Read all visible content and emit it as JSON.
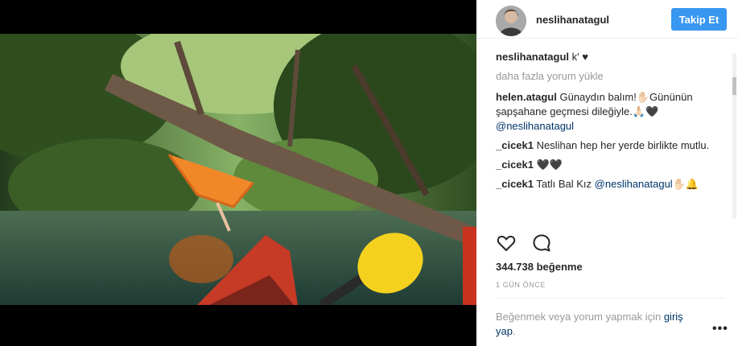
{
  "post": {
    "username": "neslihanatagul",
    "follow_label": "Takip Et",
    "caption": "k' ♥",
    "load_more": "daha fazla yorum yükle",
    "comments": [
      {
        "user": "helen.atagul",
        "text": "Günaydın balım!✋🏻Gününün şapşahane geçmesi dileğiyle.🙏🏻🖤",
        "mention": "@neslihanatagul"
      },
      {
        "user": "_cicek1",
        "text": "Neslihan hep her yerde birlikte mutlu."
      },
      {
        "user": "_cicek1",
        "text": "🖤🖤"
      },
      {
        "user": "_cicek1",
        "text": "Tatlı Bal Kız",
        "mention": "@neslihanatagul",
        "suffix": "✋🏻🔔"
      }
    ],
    "likes": "344.738 beğenme",
    "timestamp": "1 GÜN ÖNCE",
    "login_prompt": "Beğenmek veya yorum yapmak için",
    "login_link": "giriş yap",
    "login_suffix": ".",
    "more_label": "•••"
  },
  "icons": {
    "like": "heart-icon",
    "comment": "comment-icon"
  },
  "colors": {
    "follow_button": "#3897f0",
    "link": "#003569",
    "muted": "#999999"
  }
}
